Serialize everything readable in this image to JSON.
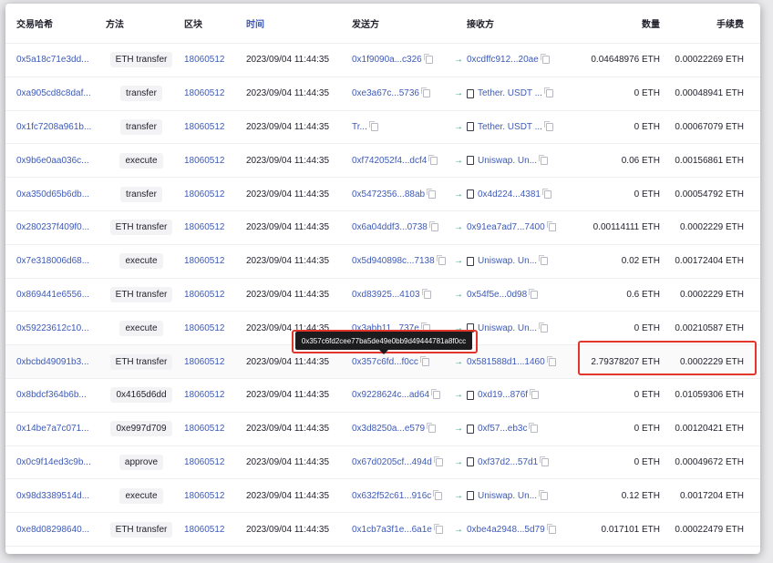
{
  "headers": {
    "hash": "交易哈希",
    "method": "方法",
    "block": "区块",
    "time": "时间",
    "from": "发送方",
    "to": "接收方",
    "value": "数量",
    "fee": "手续费"
  },
  "arrow": "→",
  "tooltip_text": "0x357c6fd2cee77ba5de49e0bb9d49444781a8f0cc",
  "highlight_color": "#e2362c",
  "link_color": "#3d5ab8",
  "rows": [
    {
      "hash": "0x5a18c71e3dd...",
      "method": "ETH transfer",
      "block": "18060512",
      "time": "2023/09/04 11:44:35",
      "from": "0x1f9090a...c326",
      "to": "0xcdffc912...20ae",
      "to_is_contract": false,
      "value": "0.04648976 ETH",
      "fee": "0.00022269 ETH"
    },
    {
      "hash": "0xa905cd8c8daf...",
      "method": "transfer",
      "block": "18060512",
      "time": "2023/09/04 11:44:35",
      "from": "0xe3a67c...5736",
      "to": "Tether. USDT ...",
      "to_is_contract": true,
      "value": "0 ETH",
      "fee": "0.00048941 ETH"
    },
    {
      "hash": "0x1fc7208a961b...",
      "method": "transfer",
      "block": "18060512",
      "time": "2023/09/04 11:44:35",
      "from": "Tr...",
      "to": "Tether. USDT ...",
      "to_is_contract": true,
      "value": "0 ETH",
      "fee": "0.00067079 ETH"
    },
    {
      "hash": "0x9b6e0aa036c...",
      "method": "execute",
      "block": "18060512",
      "time": "2023/09/04 11:44:35",
      "from": "0xf742052f4...dcf4",
      "to": "Uniswap. Un...",
      "to_is_contract": true,
      "value": "0.06 ETH",
      "fee": "0.00156861 ETH"
    },
    {
      "hash": "0xa350d65b6db...",
      "method": "transfer",
      "block": "18060512",
      "time": "2023/09/04 11:44:35",
      "from": "0x5472356...88ab",
      "to": "0x4d224...4381",
      "to_is_contract": true,
      "value": "0 ETH",
      "fee": "0.00054792 ETH"
    },
    {
      "hash": "0x280237f409f0...",
      "method": "ETH transfer",
      "block": "18060512",
      "time": "2023/09/04 11:44:35",
      "from": "0x6a04ddf3...0738",
      "to": "0x91ea7ad7...7400",
      "to_is_contract": false,
      "value": "0.00114111 ETH",
      "fee": "0.0002229 ETH"
    },
    {
      "hash": "0x7e318006d68...",
      "method": "execute",
      "block": "18060512",
      "time": "2023/09/04 11:44:35",
      "from": "0x5d940898c...7138",
      "to": "Uniswap. Un...",
      "to_is_contract": true,
      "value": "0.02 ETH",
      "fee": "0.00172404 ETH"
    },
    {
      "hash": "0x869441e6556...",
      "method": "ETH transfer",
      "block": "18060512",
      "time": "2023/09/04 11:44:35",
      "from": "0xd83925...4103",
      "to": "0x54f5e...0d98",
      "to_is_contract": false,
      "value": "0.6 ETH",
      "fee": "0.0002229 ETH"
    },
    {
      "hash": "0x59223612c10...",
      "method": "execute",
      "block": "18060512",
      "time": "2023/09/04 11:44:35",
      "from": "0x3abb11...737e",
      "to": "Uniswap. Un...",
      "to_is_contract": true,
      "value": "0 ETH",
      "fee": "0.00210587 ETH"
    },
    {
      "hash": "0xbcbd49091b3...",
      "method": "ETH transfer",
      "block": "18060512",
      "time": "2023/09/04 11:44:35",
      "from": "0x357c6fd...f0cc",
      "to": "0x581588d1...1460",
      "to_is_contract": false,
      "value": "2.79378207 ETH",
      "fee": "0.0002229 ETH"
    },
    {
      "hash": "0x8bdcf364b6b...",
      "method": "0x4165d6dd",
      "block": "18060512",
      "time": "2023/09/04 11:44:35",
      "from": "0x9228624c...ad64",
      "to": "0xd19...876f",
      "to_is_contract": true,
      "value": "0 ETH",
      "fee": "0.01059306 ETH"
    },
    {
      "hash": "0x14be7a7c071...",
      "method": "0xe997d709",
      "block": "18060512",
      "time": "2023/09/04 11:44:35",
      "from": "0x3d8250a...e579",
      "to": "0xf57...eb3c",
      "to_is_contract": true,
      "value": "0 ETH",
      "fee": "0.00120421 ETH"
    },
    {
      "hash": "0x0c9f14ed3c9b...",
      "method": "approve",
      "block": "18060512",
      "time": "2023/09/04 11:44:35",
      "from": "0x67d0205cf...494d",
      "to": "0xf37d2...57d1",
      "to_is_contract": true,
      "value": "0 ETH",
      "fee": "0.00049672 ETH"
    },
    {
      "hash": "0x98d3389514d...",
      "method": "execute",
      "block": "18060512",
      "time": "2023/09/04 11:44:35",
      "from": "0x632f52c61...916c",
      "to": "Uniswap. Un...",
      "to_is_contract": true,
      "value": "0.12 ETH",
      "fee": "0.0017204 ETH"
    },
    {
      "hash": "0xe8d08298640...",
      "method": "ETH transfer",
      "block": "18060512",
      "time": "2023/09/04 11:44:35",
      "from": "0x1cb7a3f1e...6a1e",
      "to": "0xbe4a2948...5d79",
      "to_is_contract": false,
      "value": "0.017101 ETH",
      "fee": "0.00022479 ETH"
    }
  ]
}
